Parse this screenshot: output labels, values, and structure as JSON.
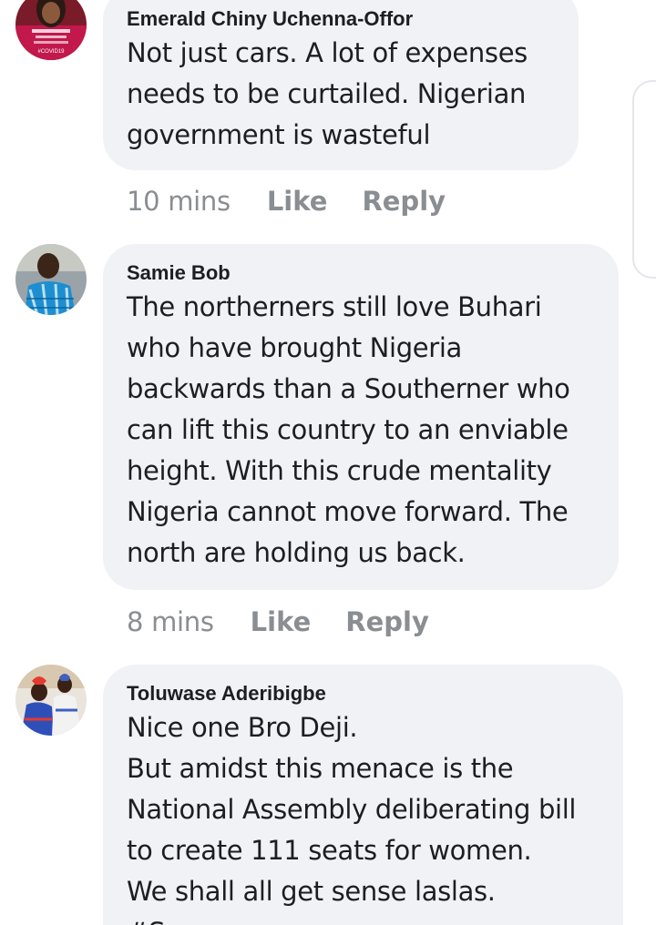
{
  "comments": [
    {
      "author": "Emerald Chiny Uchenna-Offor",
      "text": "Not just cars. A lot of expenses\nneeds to be curtailed. Nigerian\ngovernment is wasteful",
      "time": "10 mins",
      "like_label": "Like",
      "reply_label": "Reply",
      "avatar_badge_text": "#COVID19"
    },
    {
      "author": "Samie Bob",
      "text": "The northerners still love Buhari\nwho have brought Nigeria\nbackwards than a Southerner who\ncan lift this country to an enviable\nheight. With this crude mentality\nNigeria cannot move forward. The\nnorth are holding us back.",
      "time": "8 mins",
      "like_label": "Like",
      "reply_label": "Reply"
    },
    {
      "author": "Toluwase Aderibigbe",
      "text": "Nice one Bro Deji.\nBut amidst this menace is the\nNational Assembly deliberating bill\nto create 111 seats for women.\nWe shall all get sense laslas.\n#S",
      "time": "",
      "like_label": "",
      "reply_label": ""
    }
  ],
  "colors": {
    "bubble": "#f0f2f5",
    "text": "#1c1e21",
    "meta": "#8a8d91"
  }
}
